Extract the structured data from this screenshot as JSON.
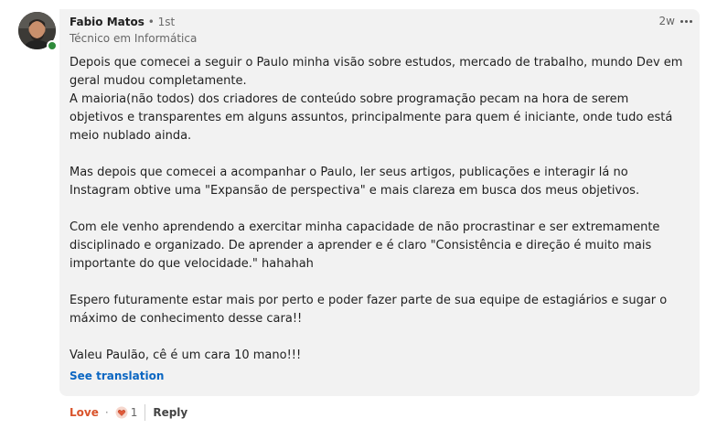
{
  "comment": {
    "author": {
      "name": "Fabio Matos",
      "degree": "• 1st",
      "headline": "Técnico em Informática",
      "online": true
    },
    "timestamp": "2w",
    "more_icon": "ellipsis-icon",
    "paragraphs": [
      "Depois que comecei a seguir o Paulo minha visão sobre estudos, mercado de trabalho, mundo Dev em geral mudou completamente.",
      "A maioria(não todos) dos criadores de conteúdo sobre programação pecam na hora de serem objetivos e transparentes em alguns assuntos, principalmente para quem é iniciante, onde tudo está meio nublado ainda.",
      "Mas depois que comecei a acompanhar o Paulo, ler seus artigos, publicações e interagir lá no Instagram obtive uma \"Expansão de perspectiva\" e mais clareza em busca dos meus objetivos.",
      "Com ele venho aprendendo a exercitar minha capacidade de não procrastinar e ser extremamente disciplinado e organizado. De aprender a aprender e é claro \"Consistência e direção é muito mais importante do que velocidade.\" hahahah",
      "Espero futuramente estar mais por perto e poder fazer parte de sua equipe de estagiários e sugar o máximo de conhecimento desse cara!!",
      "Valeu Paulão, cê é um cara 10 mano!!!"
    ],
    "see_translation": "See translation"
  },
  "actions": {
    "love_label": "Love",
    "separator": "·",
    "reaction_icon": "heart-icon",
    "reaction_count": "1",
    "reply_label": "Reply"
  },
  "colors": {
    "bubble": "#f2f2f2",
    "link": "#0a66c2",
    "love": "#d9532b",
    "online": "#2e8b3a"
  }
}
